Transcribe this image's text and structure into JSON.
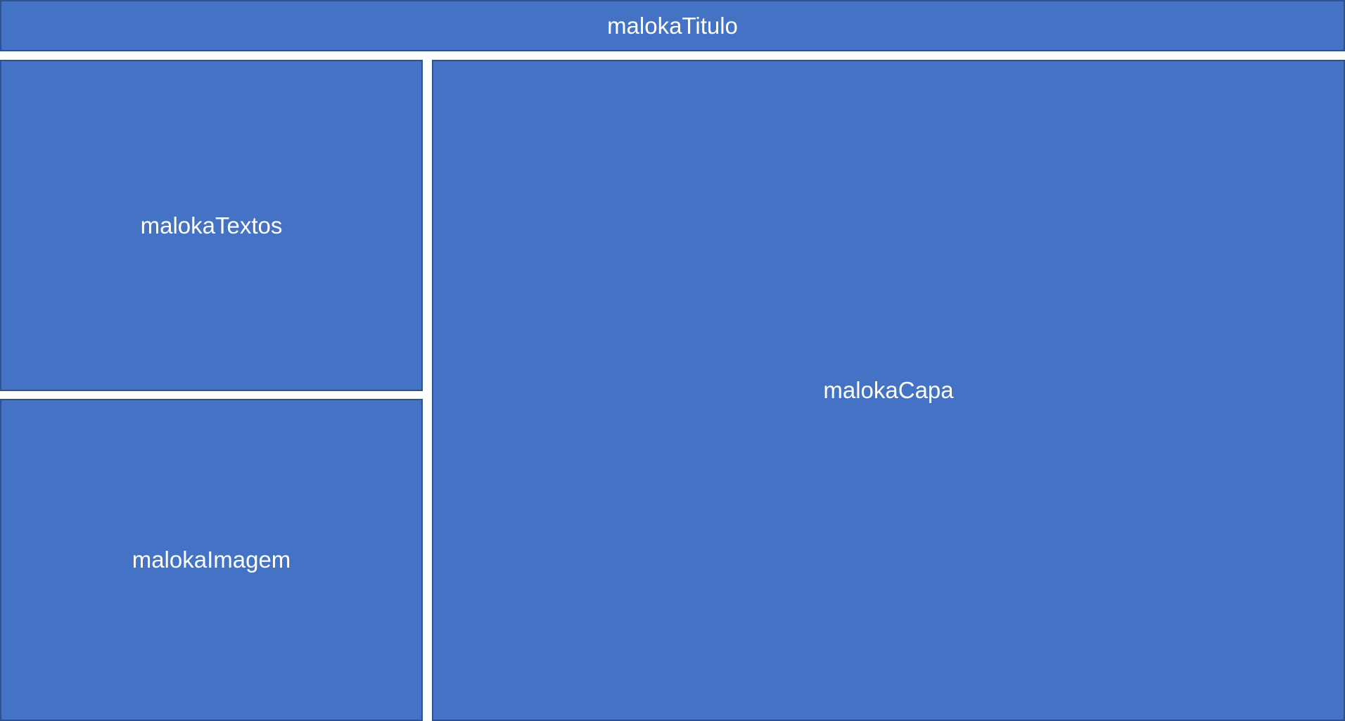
{
  "colors": {
    "block_fill": "#4472C4",
    "block_border": "#2F528F",
    "text": "#FFFFFF",
    "background": "#FFFFFF"
  },
  "blocks": {
    "titulo": {
      "label": "malokaTitulo"
    },
    "textos": {
      "label": "malokaTextos"
    },
    "imagem": {
      "label": "malokaImagem"
    },
    "capa": {
      "label": "malokaCapa"
    }
  }
}
